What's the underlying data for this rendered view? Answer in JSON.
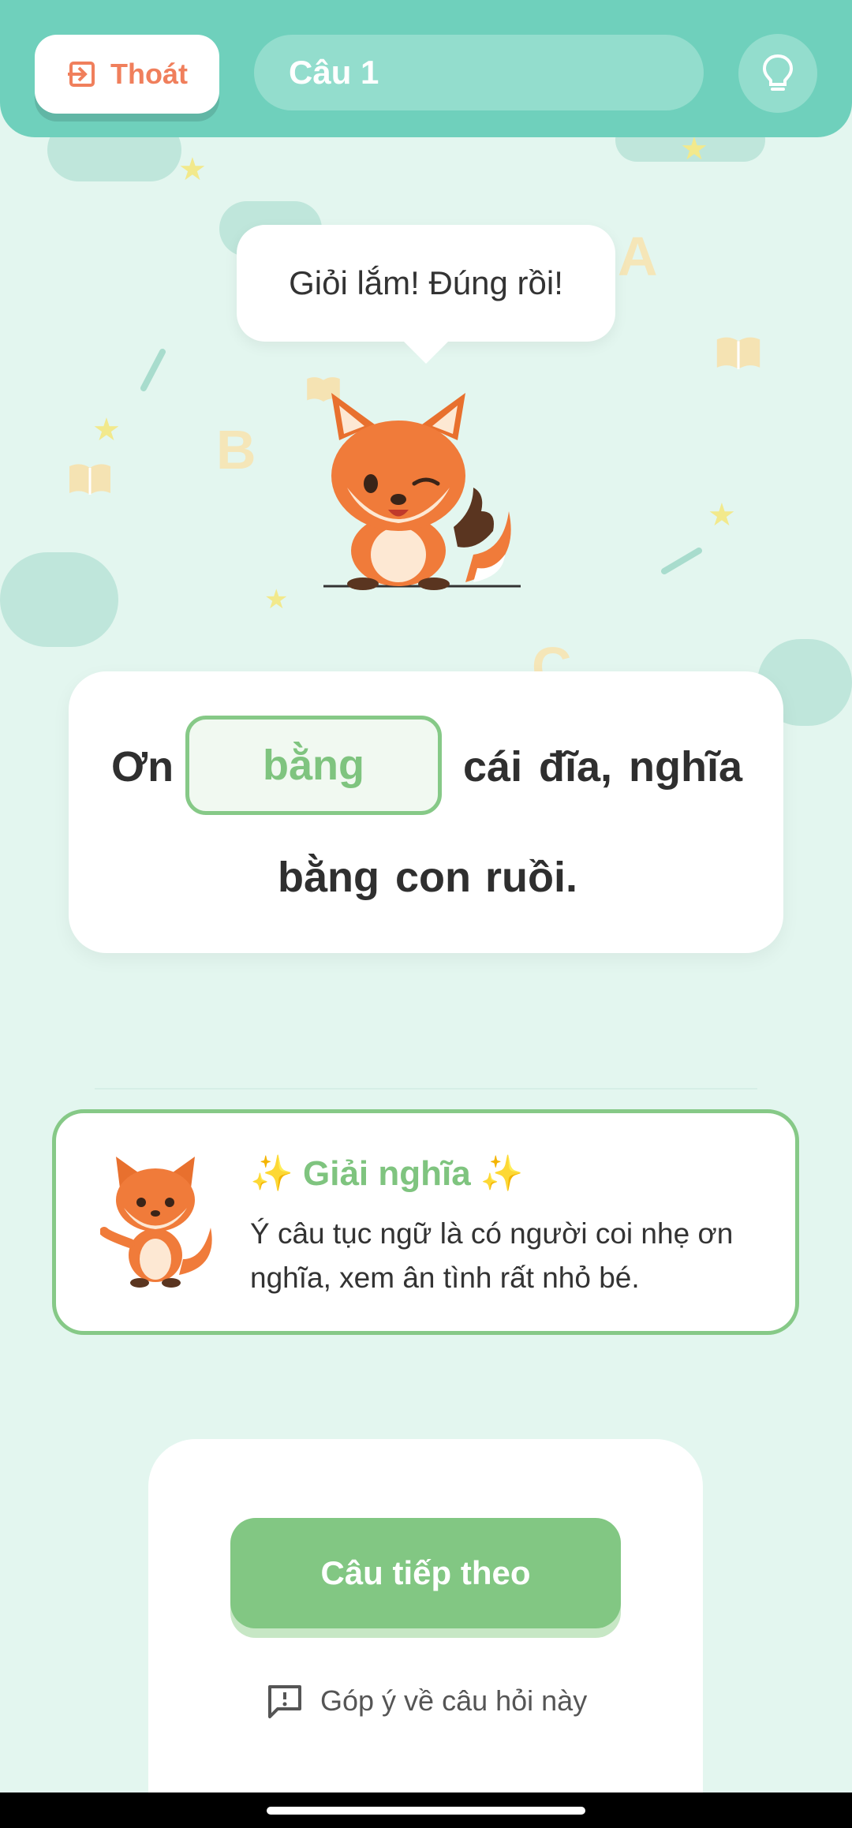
{
  "header": {
    "exit_label": "Thoát",
    "question_label": "Câu 1"
  },
  "bubble": {
    "text": "Giỏi lắm! Đúng rồi!"
  },
  "sentence": {
    "before": "Ơn",
    "answer": "bằng",
    "after_line1": [
      "cái",
      "đĩa,",
      "nghĩa"
    ],
    "line2": [
      "bằng",
      "con",
      "ruồi."
    ]
  },
  "meaning": {
    "title": "✨ Giải nghĩa ✨",
    "text": "Ý câu tục ngữ là có người coi nhẹ ơn nghĩa, xem ân tình rất nhỏ bé."
  },
  "actions": {
    "next_label": "Câu tiếp theo",
    "feedback_label": "Góp ý về câu hỏi này"
  },
  "decorations": {
    "letters": [
      "A",
      "B",
      "C"
    ]
  },
  "colors": {
    "header": "#6fd0bc",
    "accent_green": "#82c783",
    "exit_orange": "#f07f5c",
    "background": "#e3f6ef"
  }
}
